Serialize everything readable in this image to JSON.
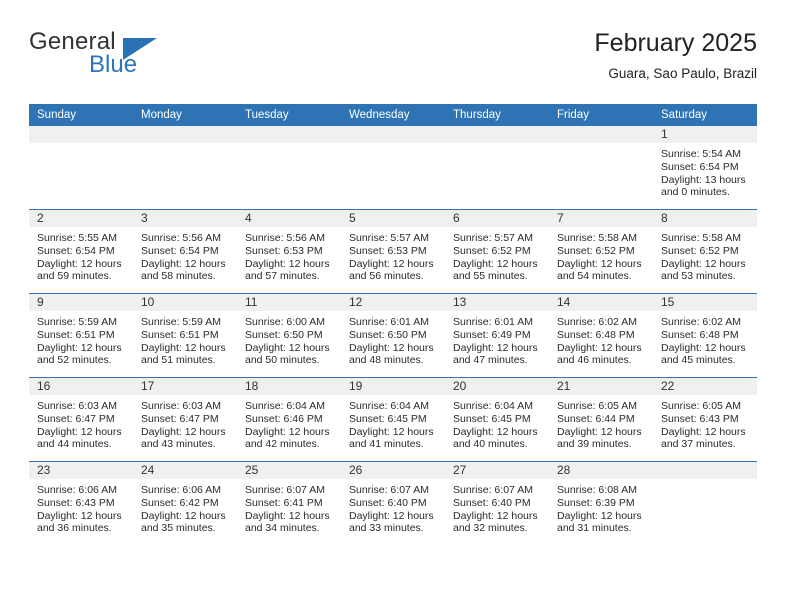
{
  "logo": {
    "word_top": "General",
    "word_bottom": "Blue",
    "triangle_color": "#2b72b5",
    "blue_color": "#2c75b8"
  },
  "header": {
    "title": "February 2025",
    "subtitle": "Guara, Sao Paulo, Brazil"
  },
  "theme": {
    "header_blue": "#2e74b5",
    "daynum_band": "#f0f0f0",
    "row_rule": "#2e74b5"
  },
  "weekday_headers": [
    "Sunday",
    "Monday",
    "Tuesday",
    "Wednesday",
    "Thursday",
    "Friday",
    "Saturday"
  ],
  "labels": {
    "sunrise": "Sunrise:",
    "sunset": "Sunset:",
    "daylight": "Daylight:"
  },
  "weeks": [
    [
      {
        "day": "",
        "sunrise": "",
        "sunset": "",
        "daylight": ""
      },
      {
        "day": "",
        "sunrise": "",
        "sunset": "",
        "daylight": ""
      },
      {
        "day": "",
        "sunrise": "",
        "sunset": "",
        "daylight": ""
      },
      {
        "day": "",
        "sunrise": "",
        "sunset": "",
        "daylight": ""
      },
      {
        "day": "",
        "sunrise": "",
        "sunset": "",
        "daylight": ""
      },
      {
        "day": "",
        "sunrise": "",
        "sunset": "",
        "daylight": ""
      },
      {
        "day": "1",
        "sunrise": "Sunrise: 5:54 AM",
        "sunset": "Sunset: 6:54 PM",
        "daylight": "Daylight: 13 hours and 0 minutes."
      }
    ],
    [
      {
        "day": "2",
        "sunrise": "Sunrise: 5:55 AM",
        "sunset": "Sunset: 6:54 PM",
        "daylight": "Daylight: 12 hours and 59 minutes."
      },
      {
        "day": "3",
        "sunrise": "Sunrise: 5:56 AM",
        "sunset": "Sunset: 6:54 PM",
        "daylight": "Daylight: 12 hours and 58 minutes."
      },
      {
        "day": "4",
        "sunrise": "Sunrise: 5:56 AM",
        "sunset": "Sunset: 6:53 PM",
        "daylight": "Daylight: 12 hours and 57 minutes."
      },
      {
        "day": "5",
        "sunrise": "Sunrise: 5:57 AM",
        "sunset": "Sunset: 6:53 PM",
        "daylight": "Daylight: 12 hours and 56 minutes."
      },
      {
        "day": "6",
        "sunrise": "Sunrise: 5:57 AM",
        "sunset": "Sunset: 6:52 PM",
        "daylight": "Daylight: 12 hours and 55 minutes."
      },
      {
        "day": "7",
        "sunrise": "Sunrise: 5:58 AM",
        "sunset": "Sunset: 6:52 PM",
        "daylight": "Daylight: 12 hours and 54 minutes."
      },
      {
        "day": "8",
        "sunrise": "Sunrise: 5:58 AM",
        "sunset": "Sunset: 6:52 PM",
        "daylight": "Daylight: 12 hours and 53 minutes."
      }
    ],
    [
      {
        "day": "9",
        "sunrise": "Sunrise: 5:59 AM",
        "sunset": "Sunset: 6:51 PM",
        "daylight": "Daylight: 12 hours and 52 minutes."
      },
      {
        "day": "10",
        "sunrise": "Sunrise: 5:59 AM",
        "sunset": "Sunset: 6:51 PM",
        "daylight": "Daylight: 12 hours and 51 minutes."
      },
      {
        "day": "11",
        "sunrise": "Sunrise: 6:00 AM",
        "sunset": "Sunset: 6:50 PM",
        "daylight": "Daylight: 12 hours and 50 minutes."
      },
      {
        "day": "12",
        "sunrise": "Sunrise: 6:01 AM",
        "sunset": "Sunset: 6:50 PM",
        "daylight": "Daylight: 12 hours and 48 minutes."
      },
      {
        "day": "13",
        "sunrise": "Sunrise: 6:01 AM",
        "sunset": "Sunset: 6:49 PM",
        "daylight": "Daylight: 12 hours and 47 minutes."
      },
      {
        "day": "14",
        "sunrise": "Sunrise: 6:02 AM",
        "sunset": "Sunset: 6:48 PM",
        "daylight": "Daylight: 12 hours and 46 minutes."
      },
      {
        "day": "15",
        "sunrise": "Sunrise: 6:02 AM",
        "sunset": "Sunset: 6:48 PM",
        "daylight": "Daylight: 12 hours and 45 minutes."
      }
    ],
    [
      {
        "day": "16",
        "sunrise": "Sunrise: 6:03 AM",
        "sunset": "Sunset: 6:47 PM",
        "daylight": "Daylight: 12 hours and 44 minutes."
      },
      {
        "day": "17",
        "sunrise": "Sunrise: 6:03 AM",
        "sunset": "Sunset: 6:47 PM",
        "daylight": "Daylight: 12 hours and 43 minutes."
      },
      {
        "day": "18",
        "sunrise": "Sunrise: 6:04 AM",
        "sunset": "Sunset: 6:46 PM",
        "daylight": "Daylight: 12 hours and 42 minutes."
      },
      {
        "day": "19",
        "sunrise": "Sunrise: 6:04 AM",
        "sunset": "Sunset: 6:45 PM",
        "daylight": "Daylight: 12 hours and 41 minutes."
      },
      {
        "day": "20",
        "sunrise": "Sunrise: 6:04 AM",
        "sunset": "Sunset: 6:45 PM",
        "daylight": "Daylight: 12 hours and 40 minutes."
      },
      {
        "day": "21",
        "sunrise": "Sunrise: 6:05 AM",
        "sunset": "Sunset: 6:44 PM",
        "daylight": "Daylight: 12 hours and 39 minutes."
      },
      {
        "day": "22",
        "sunrise": "Sunrise: 6:05 AM",
        "sunset": "Sunset: 6:43 PM",
        "daylight": "Daylight: 12 hours and 37 minutes."
      }
    ],
    [
      {
        "day": "23",
        "sunrise": "Sunrise: 6:06 AM",
        "sunset": "Sunset: 6:43 PM",
        "daylight": "Daylight: 12 hours and 36 minutes."
      },
      {
        "day": "24",
        "sunrise": "Sunrise: 6:06 AM",
        "sunset": "Sunset: 6:42 PM",
        "daylight": "Daylight: 12 hours and 35 minutes."
      },
      {
        "day": "25",
        "sunrise": "Sunrise: 6:07 AM",
        "sunset": "Sunset: 6:41 PM",
        "daylight": "Daylight: 12 hours and 34 minutes."
      },
      {
        "day": "26",
        "sunrise": "Sunrise: 6:07 AM",
        "sunset": "Sunset: 6:40 PM",
        "daylight": "Daylight: 12 hours and 33 minutes."
      },
      {
        "day": "27",
        "sunrise": "Sunrise: 6:07 AM",
        "sunset": "Sunset: 6:40 PM",
        "daylight": "Daylight: 12 hours and 32 minutes."
      },
      {
        "day": "28",
        "sunrise": "Sunrise: 6:08 AM",
        "sunset": "Sunset: 6:39 PM",
        "daylight": "Daylight: 12 hours and 31 minutes."
      },
      {
        "day": "",
        "sunrise": "",
        "sunset": "",
        "daylight": ""
      }
    ]
  ]
}
